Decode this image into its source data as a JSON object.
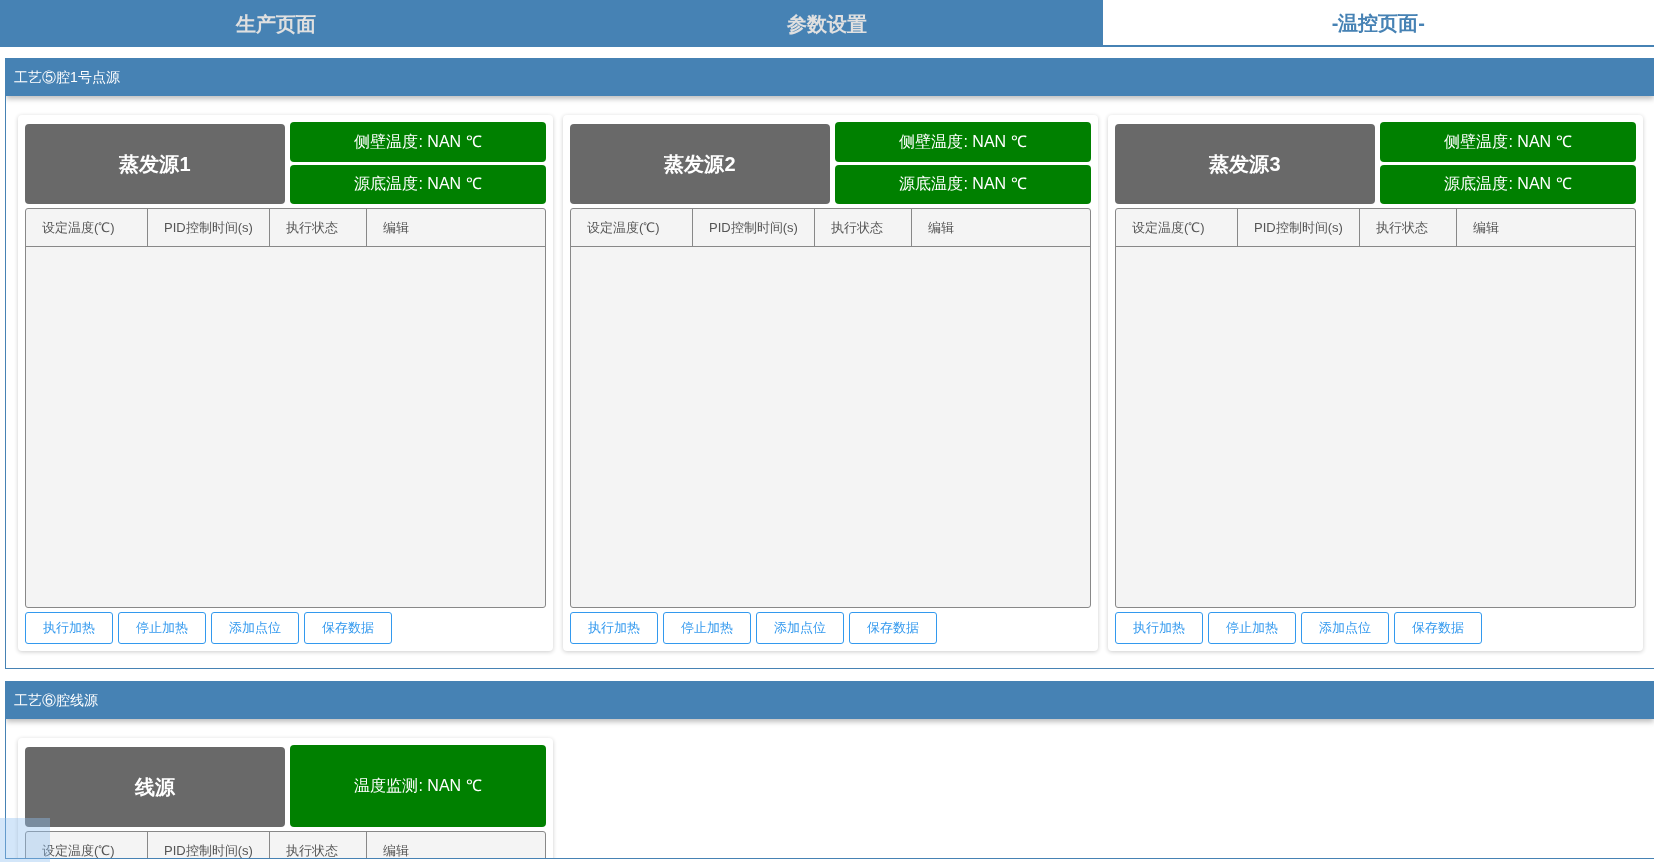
{
  "tabs": [
    {
      "label": "生产页面",
      "selected": false
    },
    {
      "label": "参数设置",
      "selected": false
    },
    {
      "label": "-温控页面-",
      "selected": true
    }
  ],
  "sections": [
    {
      "title": "工艺⑤腔1号点源",
      "sources": [
        {
          "name": "蒸发源1",
          "readings": [
            "侧壁温度: NAN ℃",
            "源底温度: NAN ℃"
          ],
          "columns": [
            "设定温度(℃)",
            "PID控制时间(s)",
            "执行状态",
            "编辑"
          ],
          "buttons": [
            "执行加热",
            "停止加热",
            "添加点位",
            "保存数据"
          ]
        },
        {
          "name": "蒸发源2",
          "readings": [
            "侧壁温度: NAN ℃",
            "源底温度: NAN ℃"
          ],
          "columns": [
            "设定温度(℃)",
            "PID控制时间(s)",
            "执行状态",
            "编辑"
          ],
          "buttons": [
            "执行加热",
            "停止加热",
            "添加点位",
            "保存数据"
          ]
        },
        {
          "name": "蒸发源3",
          "readings": [
            "侧壁温度: NAN ℃",
            "源底温度: NAN ℃"
          ],
          "columns": [
            "设定温度(℃)",
            "PID控制时间(s)",
            "执行状态",
            "编辑"
          ],
          "buttons": [
            "执行加热",
            "停止加热",
            "添加点位",
            "保存数据"
          ]
        }
      ]
    },
    {
      "title": "工艺⑥腔线源",
      "sources": [
        {
          "name": "线源",
          "readings": [
            "温度监测: NAN ℃"
          ],
          "columns": [
            "设定温度(℃)",
            "PID控制时间(s)",
            "执行状态",
            "编辑"
          ]
        }
      ]
    }
  ]
}
